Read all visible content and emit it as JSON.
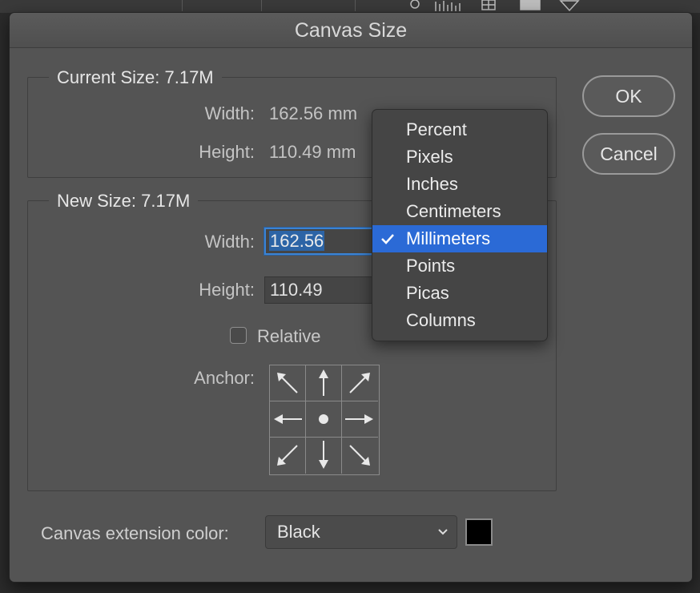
{
  "dialog": {
    "title": "Canvas Size",
    "ok_label": "OK",
    "cancel_label": "Cancel"
  },
  "current_size": {
    "title": "Current Size: 7.17M",
    "width_label": "Width:",
    "width_value": "162.56 mm",
    "height_label": "Height:",
    "height_value": "110.49 mm"
  },
  "new_size": {
    "title": "New Size: 7.17M",
    "width_label": "Width:",
    "width_value": "162.56",
    "height_label": "Height:",
    "height_value": "110.49",
    "relative_label": "Relative",
    "relative_checked": false,
    "anchor_label": "Anchor:",
    "anchor_selected": "center"
  },
  "extension": {
    "label": "Canvas extension color:",
    "selected": "Black",
    "swatch_color": "#000000"
  },
  "unit_menu": {
    "items": [
      "Percent",
      "Pixels",
      "Inches",
      "Centimeters",
      "Millimeters",
      "Points",
      "Picas",
      "Columns"
    ],
    "selected_index": 4
  },
  "colors": {
    "accent": "#2b6ad6",
    "text_selection": "#2c64a6"
  }
}
